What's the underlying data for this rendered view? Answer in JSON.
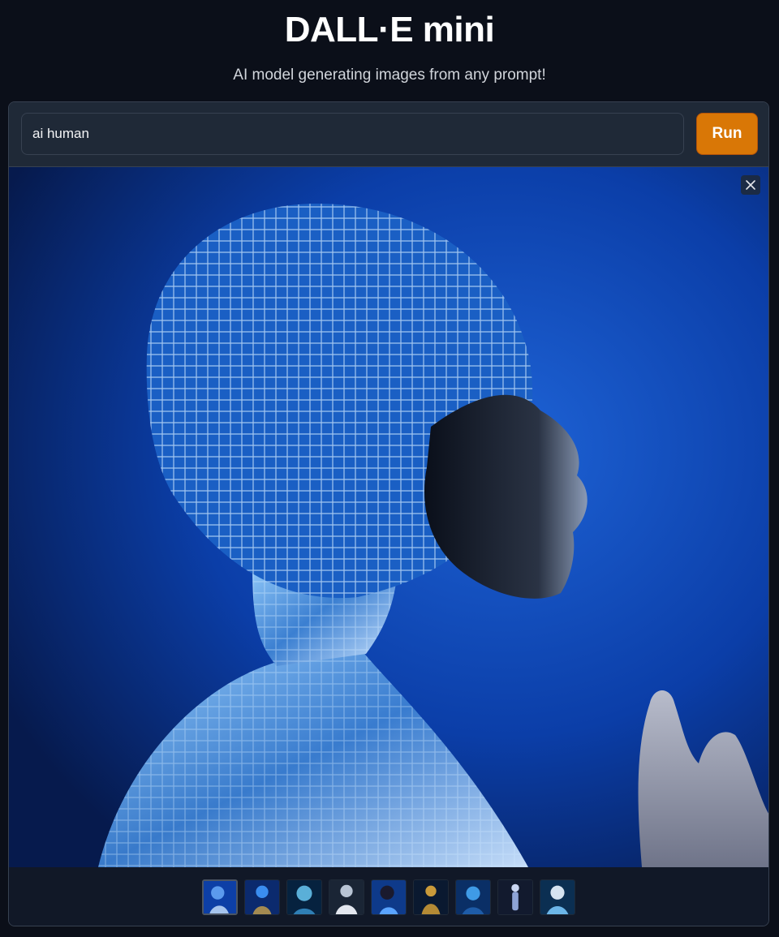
{
  "header": {
    "title": "DALL·E mini",
    "subtitle": "AI model generating images from any prompt!"
  },
  "prompt": {
    "value": "ai human"
  },
  "run_button": {
    "label": "Run"
  },
  "gallery": {
    "selected_index": 0,
    "thumbnail_count": 9,
    "accent_color": "#d97706"
  },
  "icons": {
    "close": "close-icon"
  }
}
